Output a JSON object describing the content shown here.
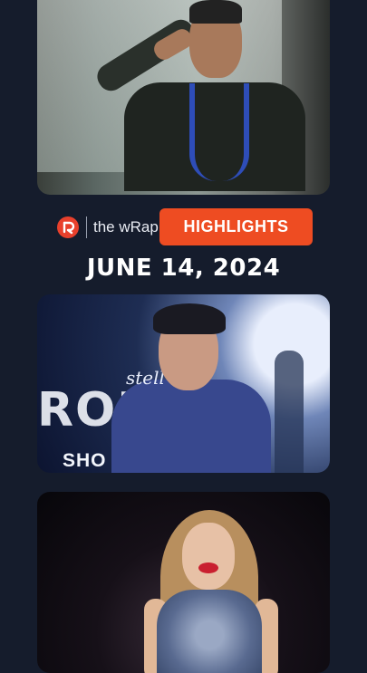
{
  "header": {
    "brand_label": "the wRap",
    "highlights_label": "HIGHLIGHTS",
    "date": "JUNE 14, 2024"
  },
  "cards": {
    "card2": {
      "big_word": "ROI",
      "sub_word": "SHO",
      "script_text": "stell"
    }
  },
  "icons": {
    "logo": "rappler-logo-icon"
  },
  "colors": {
    "background": "#151c2c",
    "accent": "#ee4c22",
    "logo": "#e8402c"
  }
}
